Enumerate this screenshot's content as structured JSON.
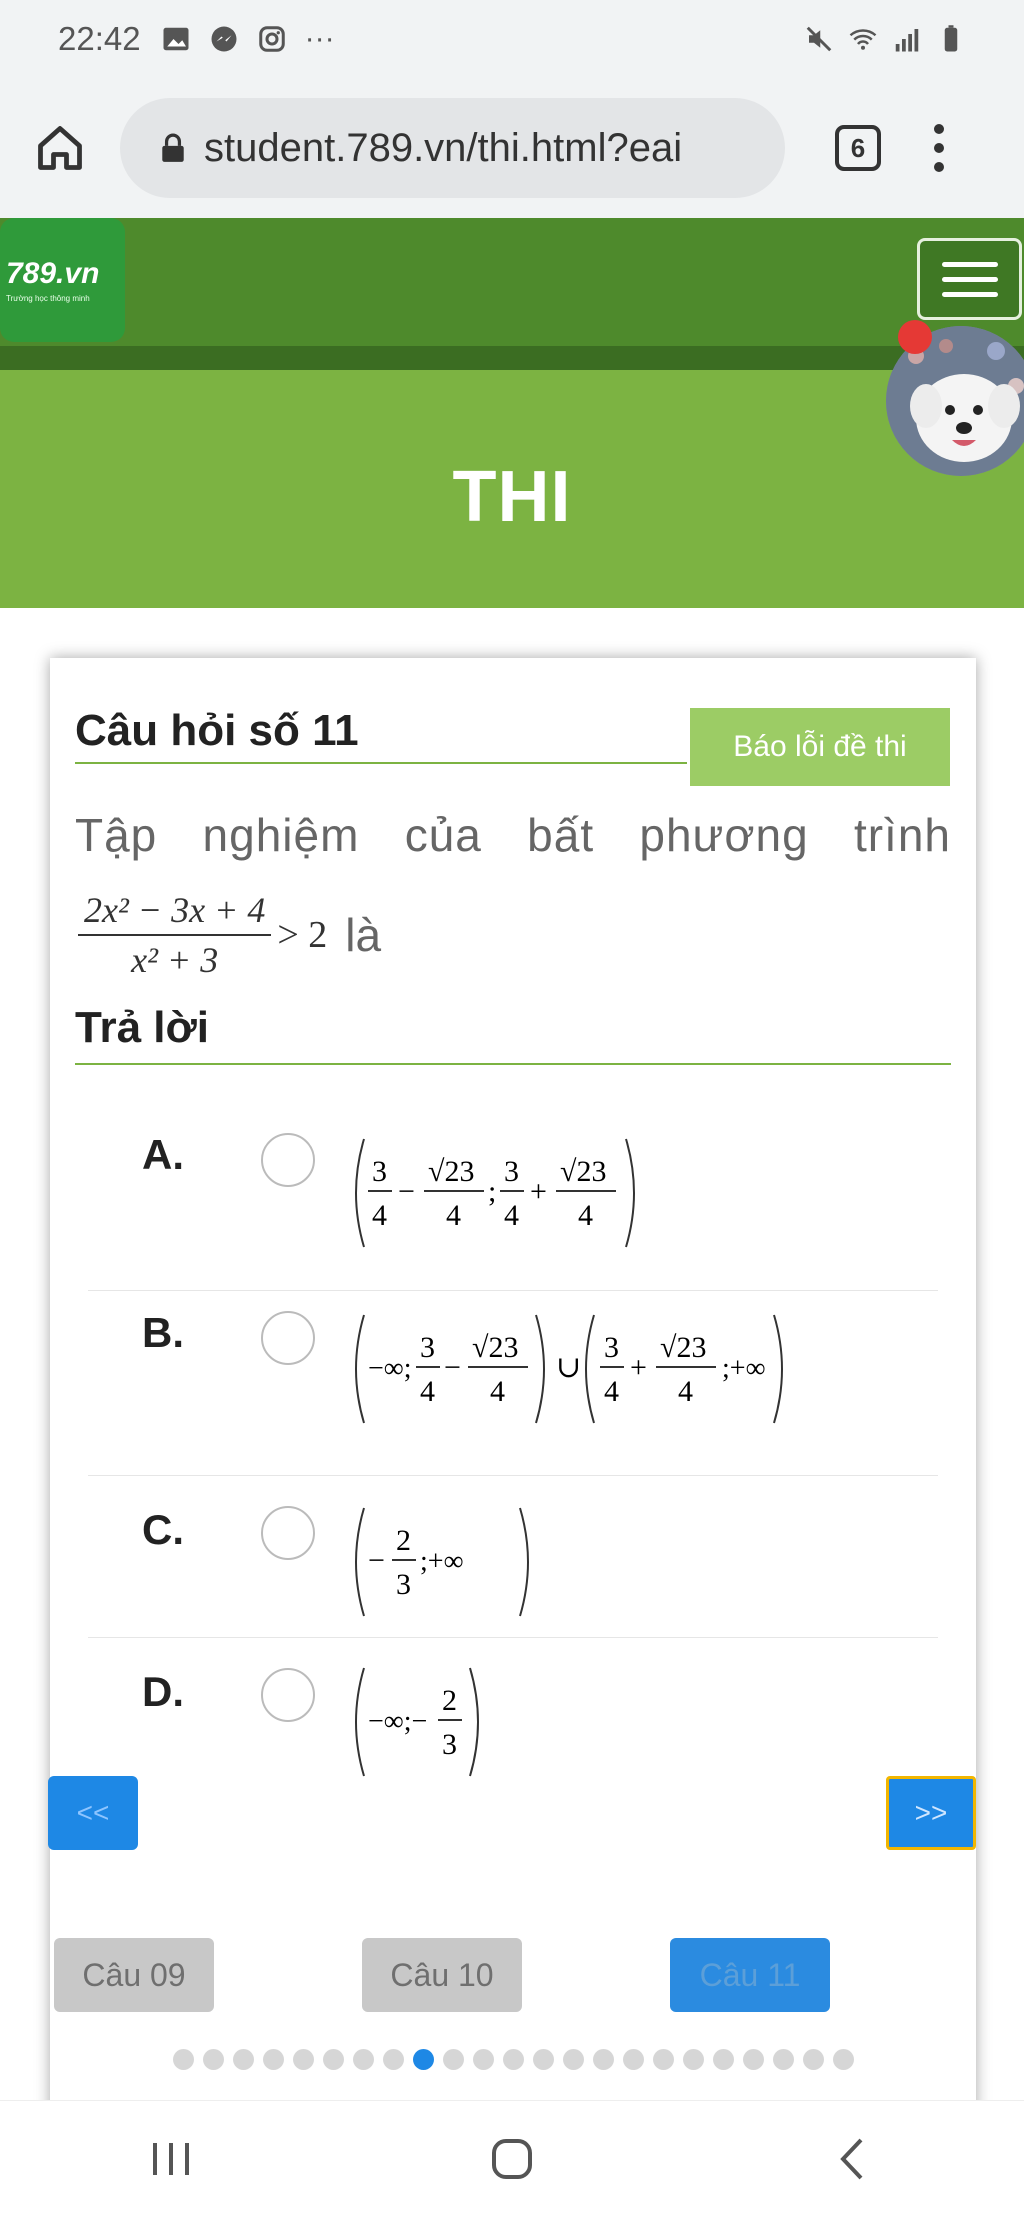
{
  "status_bar": {
    "time": "22:42",
    "left_icons": [
      "gallery-icon",
      "messenger-icon",
      "instagram-icon",
      "more-icon"
    ],
    "right_icons": [
      "mute-icon",
      "wifi-icon",
      "signal-icon",
      "battery-icon"
    ],
    "more_glyph": "···"
  },
  "browser": {
    "url": "student.789.vn/thi.html?eai",
    "tab_count": "6"
  },
  "site": {
    "logo_title": "789.vn",
    "logo_subtitle": "Trường học thông minh",
    "page_title": "THI"
  },
  "question": {
    "title": "Câu hỏi số 11",
    "report_label": "Báo lỗi đề thi",
    "text": "Tập nghiệm của bất phương trình",
    "formula_num": "2x² − 3x + 4",
    "formula_den": "x² + 3",
    "formula_rhs": "> 2",
    "suffix": "là"
  },
  "answer_heading": "Trả lời",
  "options": [
    {
      "letter": "A.",
      "math": "(3/4 − √23/4 ; 3/4 + √23/4)"
    },
    {
      "letter": "B.",
      "math": "(−∞; 3/4 − √23/4) ∪ (3/4 + √23/4; +∞)"
    },
    {
      "letter": "C.",
      "math": "(−2/3; +∞)"
    },
    {
      "letter": "D.",
      "math": "(−∞; −2/3)"
    }
  ],
  "nav": {
    "prev_label": "<<",
    "next_label": ">>",
    "question_buttons": [
      "Câu 09",
      "Câu 10",
      "Câu 11"
    ],
    "active_question": "Câu 11",
    "dot_count": 23,
    "active_dot_index": 8
  },
  "colors": {
    "header_green": "#4e8a2c",
    "hero_green": "#7cb342",
    "accent_blue": "#1e88e5",
    "report_green": "#9ccc65"
  }
}
